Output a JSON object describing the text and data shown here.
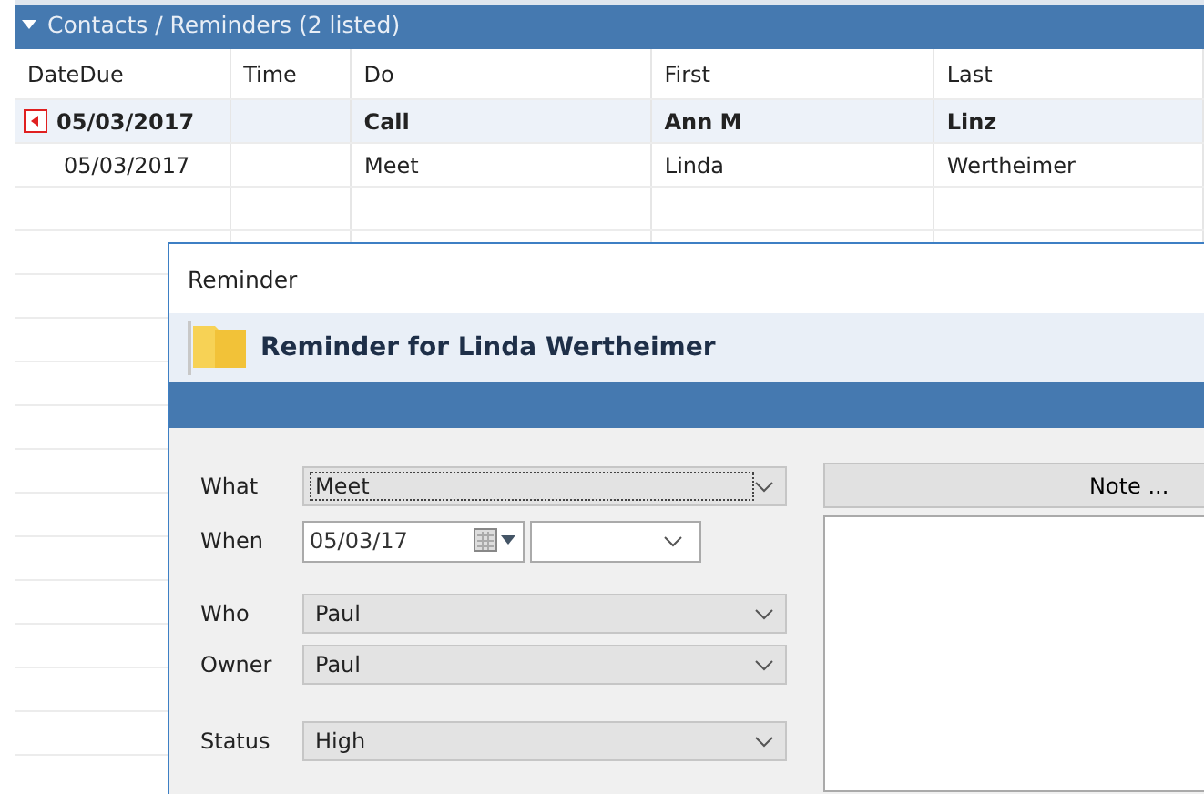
{
  "panel": {
    "title": "Contacts / Reminders (2 listed)",
    "expanded": true
  },
  "table": {
    "columns": [
      "DateDue",
      "Time",
      "Do",
      "First",
      "Last"
    ],
    "rows": [
      {
        "cells": [
          "05/03/2017",
          "",
          "Call",
          "Ann M",
          "Linz"
        ],
        "selected": true
      },
      {
        "cells": [
          "05/03/2017",
          "",
          "Meet",
          "Linda",
          "Wertheimer"
        ],
        "selected": false
      }
    ]
  },
  "dialog": {
    "title": "Reminder",
    "heading": "Reminder for Linda Wertheimer",
    "fields": [
      {
        "kind": "combo",
        "label": "What",
        "value": "Meet",
        "focused": true
      },
      {
        "kind": "datetime",
        "label": "When",
        "value": "05/03/17"
      },
      {
        "kind": "combo",
        "label": "Who",
        "value": "Paul",
        "focused": false
      },
      {
        "kind": "combo",
        "label": "Owner",
        "value": "Paul",
        "focused": false
      },
      {
        "kind": "combo",
        "label": "Status",
        "value": "High",
        "focused": false
      }
    ],
    "note_button": "Note ..."
  }
}
